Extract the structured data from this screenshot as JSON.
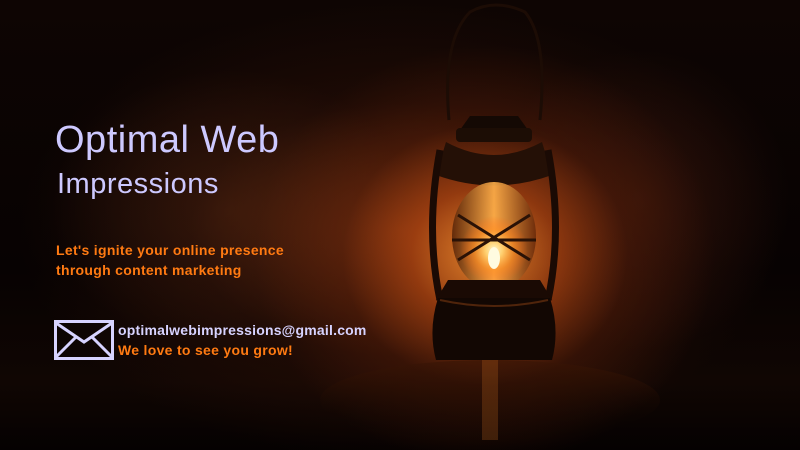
{
  "brand": {
    "title_line1": "Optimal Web",
    "title_line2": "Impressions"
  },
  "tagline": {
    "line1": "Let's ignite your online presence",
    "line2": "through content marketing"
  },
  "contact": {
    "email": "optimalwebimpressions@gmail.com",
    "slogan": "We love to see you grow!",
    "icon": "envelope-icon"
  },
  "colors": {
    "title": "#cdc9ff",
    "accent": "#ff7a12",
    "email": "#d7d3ff",
    "background": "#070202",
    "glow": "#ff9a3a"
  },
  "background_image": "oil-lantern-glowing-in-smoke"
}
